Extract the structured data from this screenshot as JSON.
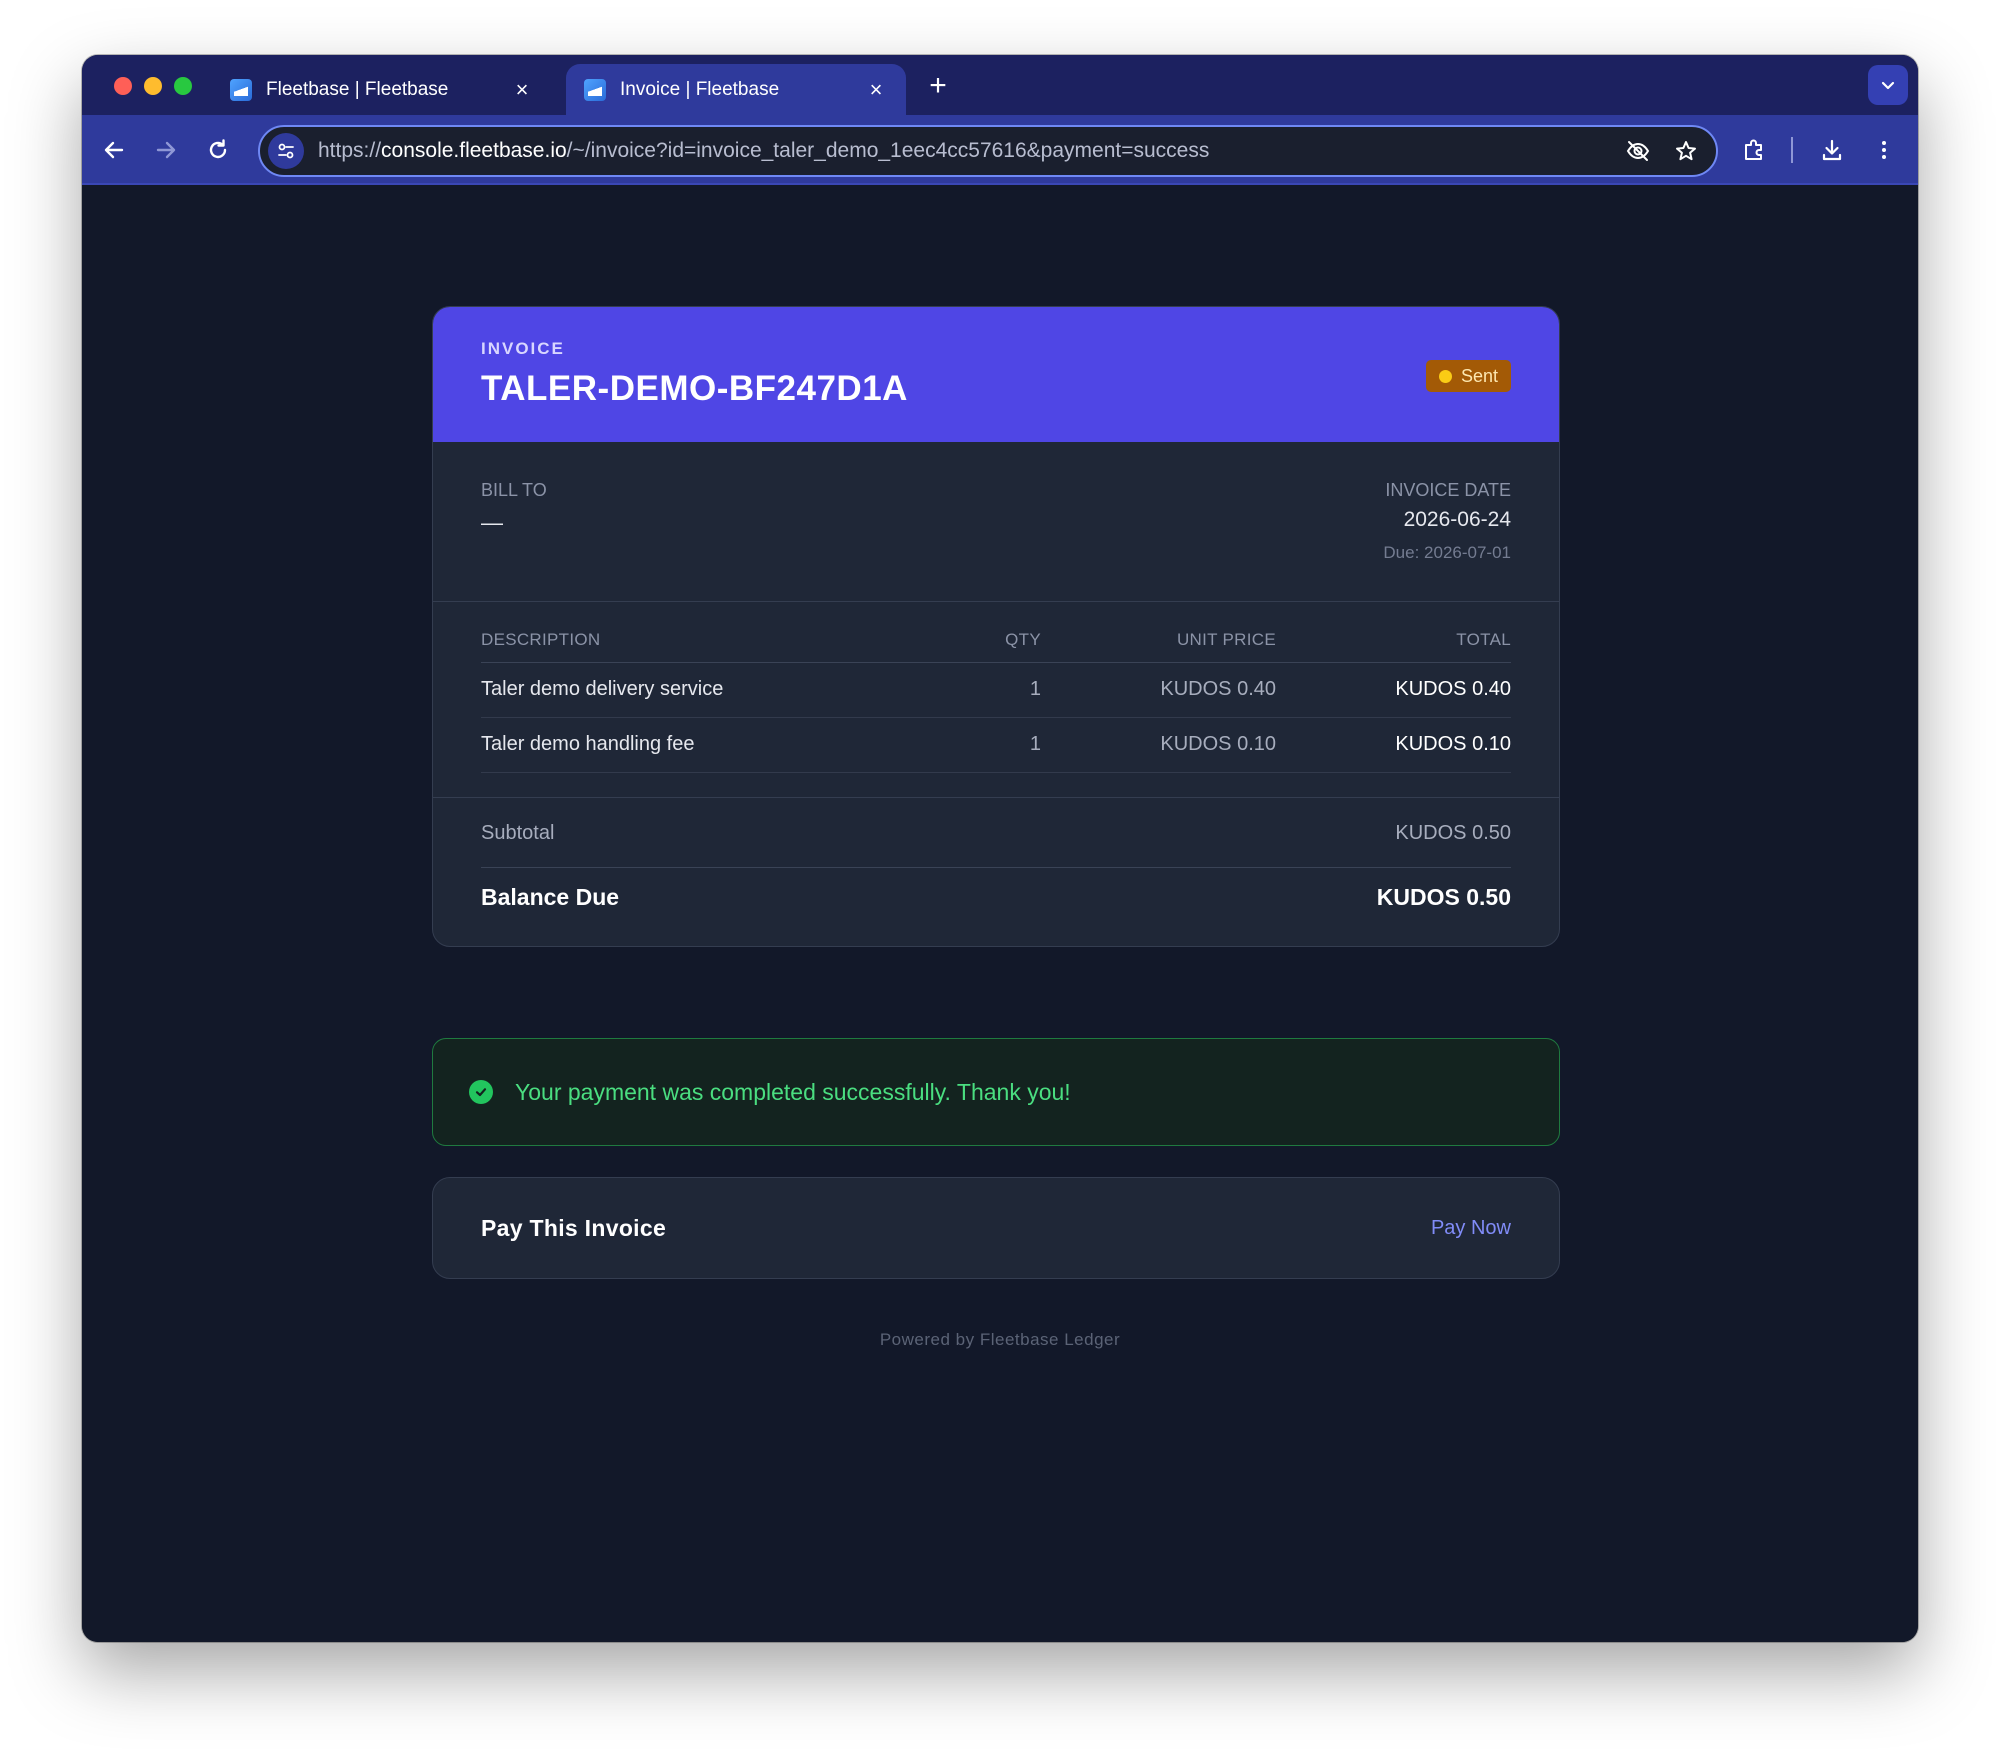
{
  "browser": {
    "tabs": [
      {
        "title": "Fleetbase | Fleetbase",
        "active": false
      },
      {
        "title": "Invoice | Fleetbase",
        "active": true
      }
    ],
    "url_scheme": "https://",
    "url_host": "console.fleetbase.io",
    "url_path": "/~/invoice?id=invoice_taler_demo_1eec4cc57616&payment=success"
  },
  "invoice": {
    "label": "INVOICE",
    "number": "TALER-DEMO-BF247D1A",
    "status": "Sent",
    "bill_to_label": "BILL TO",
    "bill_to_value": "—",
    "date_label": "INVOICE DATE",
    "date_value": "2026-06-24",
    "due_text": "Due: 2026-07-01",
    "columns": {
      "description": "DESCRIPTION",
      "qty": "QTY",
      "unit_price": "UNIT PRICE",
      "total": "TOTAL"
    },
    "items": [
      {
        "description": "Taler demo delivery service",
        "qty": "1",
        "unit_price": "KUDOS 0.40",
        "total": "KUDOS 0.40"
      },
      {
        "description": "Taler demo handling fee",
        "qty": "1",
        "unit_price": "KUDOS 0.10",
        "total": "KUDOS 0.10"
      }
    ],
    "subtotal_label": "Subtotal",
    "subtotal_value": "KUDOS 0.50",
    "balance_label": "Balance Due",
    "balance_value": "KUDOS 0.50"
  },
  "success_message": "Your payment was completed successfully. Thank you!",
  "pay": {
    "title": "Pay This Invoice",
    "action": "Pay Now"
  },
  "footer": "Powered by Fleetbase Ledger",
  "colors": {
    "brand": "#4f46e5",
    "status_badge": "#a35a06",
    "success": "#22c55e",
    "link": "#818cf8"
  }
}
